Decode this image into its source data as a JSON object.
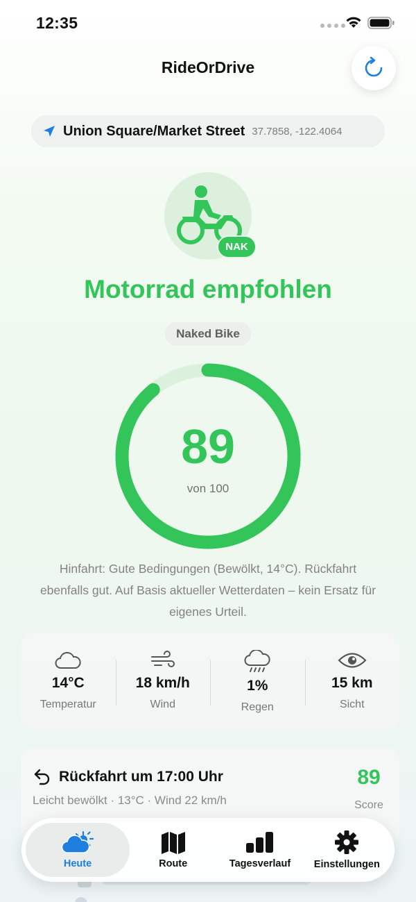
{
  "status_bar": {
    "time": "12:35"
  },
  "app": {
    "title": "RideOrDrive"
  },
  "location": {
    "name": "Union Square/Market Street",
    "coords": "37.7858, -122.4064"
  },
  "recommendation": {
    "badge": "NAK",
    "headline": "Motorrad empfohlen",
    "bike_type": "Naked Bike",
    "score": 89,
    "score_max": 100,
    "score_text": "89",
    "score_sub": "von 100",
    "summary": "Hinfahrt: Gute Bedingungen (Bewölkt, 14°C). Rückfahrt ebenfalls gut. Auf Basis aktueller Wetterdaten – kein Ersatz für eigenes Urteil."
  },
  "metrics": [
    {
      "icon": "cloud-icon",
      "value": "14°C",
      "label": "Temperatur"
    },
    {
      "icon": "wind-icon",
      "value": "18 km/h",
      "label": "Wind"
    },
    {
      "icon": "rain-cloud-icon",
      "value": "1%",
      "label": "Regen"
    },
    {
      "icon": "eye-icon",
      "value": "15 km",
      "label": "Sicht"
    }
  ],
  "return_trip": {
    "title": "Rückfahrt um 17:00 Uhr",
    "details": "Leicht bewölkt · 13°C · Wind 22 km/h",
    "score": "89",
    "score_label": "Score"
  },
  "tabs": [
    {
      "label": "Heute",
      "icon": "sun-cloud-icon",
      "active": true
    },
    {
      "label": "Route",
      "icon": "map-icon",
      "active": false
    },
    {
      "label": "Tagesverlauf",
      "icon": "bar-chart-icon",
      "active": false
    },
    {
      "label": "Einstellungen",
      "icon": "gear-icon",
      "active": false
    }
  ],
  "colors": {
    "accent_green": "#34c55a",
    "accent_blue": "#1e7fe0",
    "track_green": "#dcf1dd"
  }
}
